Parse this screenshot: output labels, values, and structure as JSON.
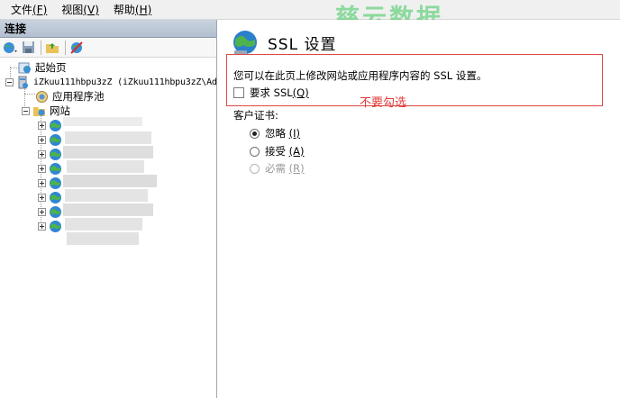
{
  "menubar": {
    "items": [
      {
        "label": "文件",
        "accel": "(F)"
      },
      {
        "label": "视图",
        "accel": "(V)"
      },
      {
        "label": "帮助",
        "accel": "(H)"
      }
    ]
  },
  "watermark": "慈云数据",
  "connections": {
    "header": "连接",
    "tree": {
      "start_page": "起始页",
      "server": "iZkuu111hbpu3zZ (iZkuu111hbpu3zZ\\Ad",
      "app_pools": "应用程序池",
      "sites": "网站"
    }
  },
  "ssl": {
    "title": "SSL 设置",
    "description": "您可以在此页上修改网站或应用程序内容的 SSL 设置。",
    "require_ssl": {
      "label": "要求 SSL",
      "accel": "(Q)",
      "checked": false
    },
    "annotation": "不要勾选",
    "client_cert_label": "客户证书:",
    "options": [
      {
        "label": "忽略",
        "accel": "(I)",
        "selected": true,
        "enabled": true
      },
      {
        "label": "接受",
        "accel": "(A)",
        "selected": false,
        "enabled": true
      },
      {
        "label": "必需",
        "accel": "(R)",
        "selected": false,
        "enabled": false
      }
    ]
  },
  "colors": {
    "annotation_red": "#e23b3b",
    "watermark_green": "#3cc85a",
    "header_bg": "#c1ccd9"
  }
}
